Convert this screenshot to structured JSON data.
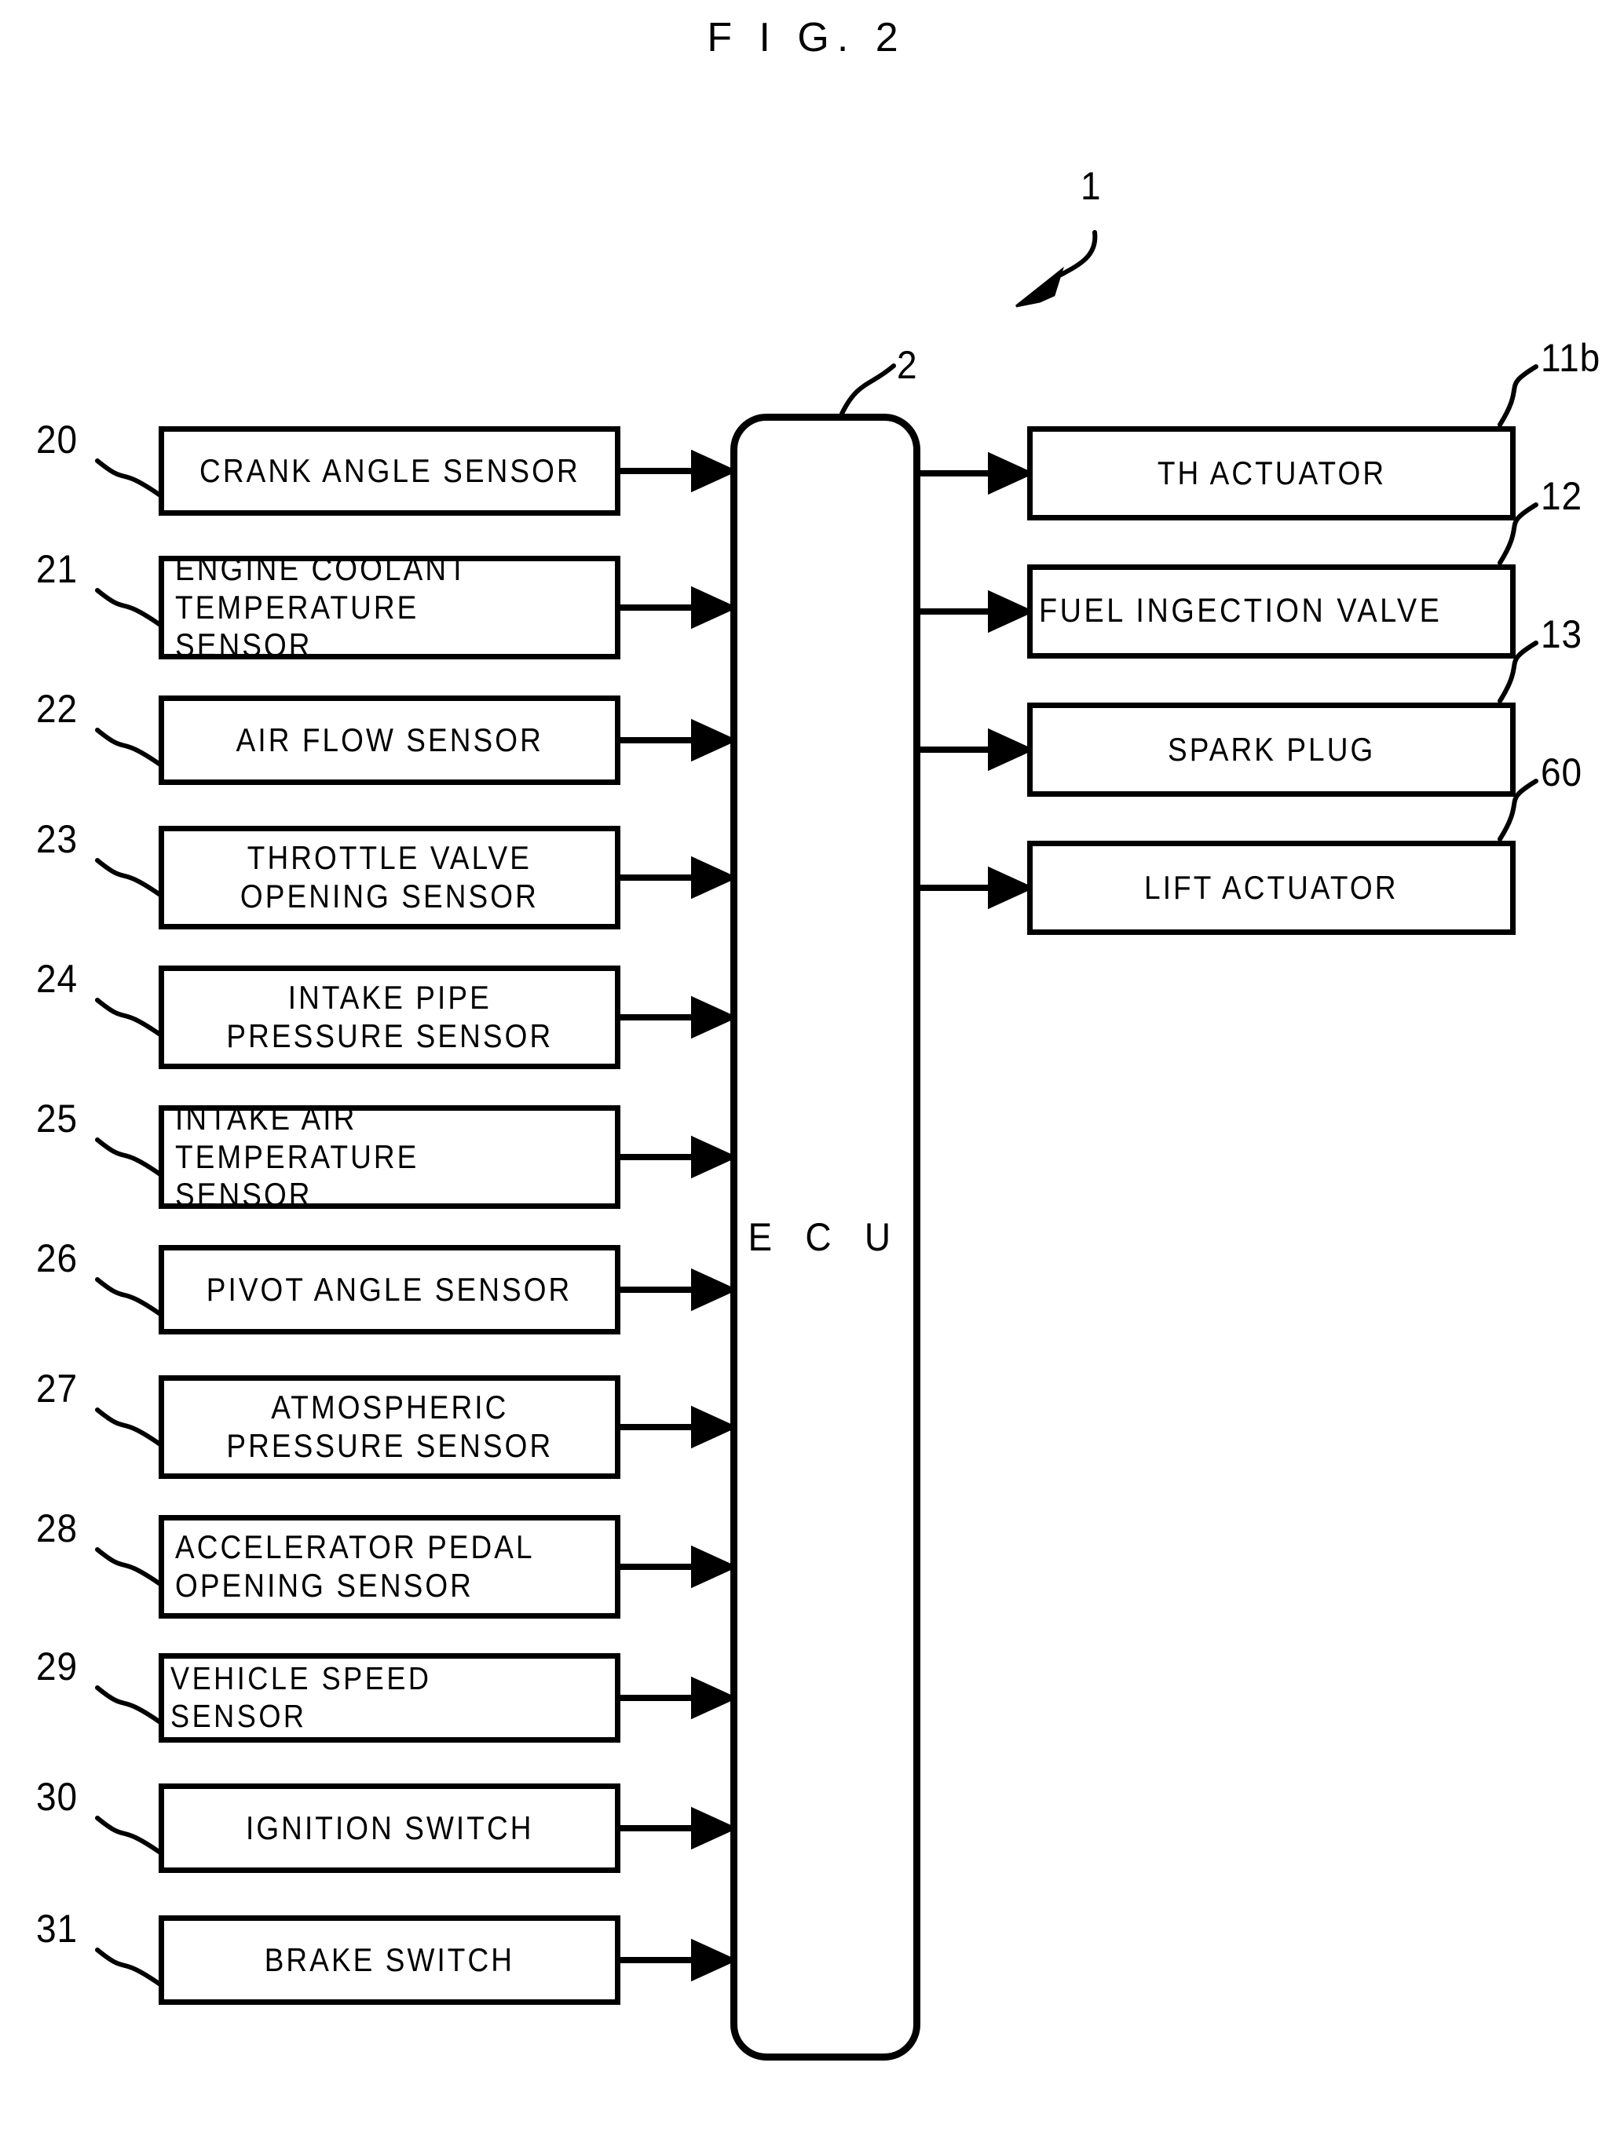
{
  "figure": {
    "title": "F I G.  2",
    "assembly_ref": "1",
    "controller_ref": "2",
    "controller_label": "E C U"
  },
  "inputs": [
    {
      "ref": "20",
      "label": "CRANK ANGLE SENSOR",
      "lines": 1,
      "align": "center"
    },
    {
      "ref": "21",
      "label": "ENGINE COOLANT\nTEMPERATURE SENSOR",
      "lines": 2,
      "align": "left"
    },
    {
      "ref": "22",
      "label": "AIR FLOW SENSOR",
      "lines": 1,
      "align": "center"
    },
    {
      "ref": "23",
      "label": "THROTTLE VALVE\nOPENING SENSOR",
      "lines": 2,
      "align": "center"
    },
    {
      "ref": "24",
      "label": "INTAKE PIPE\nPRESSURE SENSOR",
      "lines": 2,
      "align": "center"
    },
    {
      "ref": "25",
      "label": "INTAKE AIR\nTEMPERATURE SENSOR",
      "lines": 2,
      "align": "left"
    },
    {
      "ref": "26",
      "label": "PIVOT ANGLE SENSOR",
      "lines": 1,
      "align": "center"
    },
    {
      "ref": "27",
      "label": "ATMOSPHERIC\nPRESSURE SENSOR",
      "lines": 2,
      "align": "center"
    },
    {
      "ref": "28",
      "label": "ACCELERATOR PEDAL\nOPENING SENSOR",
      "lines": 2,
      "align": "left"
    },
    {
      "ref": "29",
      "label": "VEHICLE SPEED SENSOR",
      "lines": 1,
      "align": "fit"
    },
    {
      "ref": "30",
      "label": "IGNITION SWITCH",
      "lines": 1,
      "align": "center"
    },
    {
      "ref": "31",
      "label": "BRAKE SWITCH",
      "lines": 1,
      "align": "center"
    }
  ],
  "outputs": [
    {
      "ref": "11b",
      "label": "TH ACTUATOR",
      "align": "center"
    },
    {
      "ref": "12",
      "label": "FUEL INGECTION VALVE",
      "align": "fit"
    },
    {
      "ref": "13",
      "label": "SPARK PLUG",
      "align": "center"
    },
    {
      "ref": "60",
      "label": "LIFT ACTUATOR",
      "align": "center"
    }
  ],
  "colors": {
    "ink": "#000000",
    "paper": "#ffffff"
  }
}
